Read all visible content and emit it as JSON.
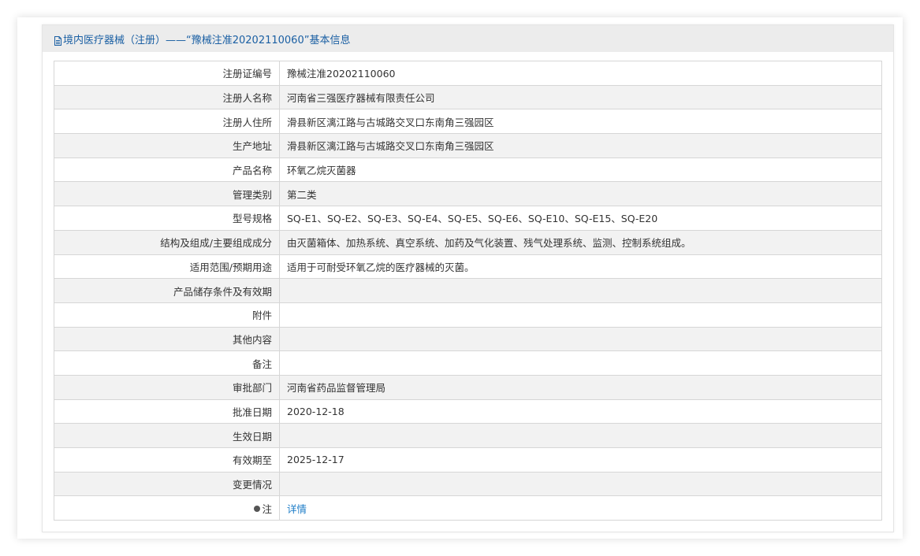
{
  "header": {
    "icon": "document-icon",
    "title": "境内医疗器械（注册）——“豫械注准20202110060”基本信息"
  },
  "rows": [
    {
      "label": "注册证编号",
      "value": "豫械注准20202110060"
    },
    {
      "label": "注册人名称",
      "value": "河南省三强医疗器械有限责任公司"
    },
    {
      "label": "注册人住所",
      "value": "滑县新区漓江路与古城路交叉口东南角三强园区"
    },
    {
      "label": "生产地址",
      "value": "滑县新区漓江路与古城路交叉口东南角三强园区"
    },
    {
      "label": "产品名称",
      "value": "环氧乙烷灭菌器"
    },
    {
      "label": "管理类别",
      "value": "第二类"
    },
    {
      "label": "型号规格",
      "value": "SQ-E1、SQ-E2、SQ-E3、SQ-E4、SQ-E5、SQ-E6、SQ-E10、SQ-E15、SQ-E20"
    },
    {
      "label": "结构及组成/主要组成成分",
      "value": "由灭菌箱体、加热系统、真空系统、加药及气化装置、残气处理系统、监测、控制系统组成。"
    },
    {
      "label": "适用范围/预期用途",
      "value": "适用于可耐受环氧乙烷的医疗器械的灭菌。"
    },
    {
      "label": "产品储存条件及有效期",
      "value": ""
    },
    {
      "label": "附件",
      "value": ""
    },
    {
      "label": "其他内容",
      "value": ""
    },
    {
      "label": "备注",
      "value": ""
    },
    {
      "label": "审批部门",
      "value": "河南省药品监督管理局"
    },
    {
      "label": "批准日期",
      "value": "2020-12-18"
    },
    {
      "label": "生效日期",
      "value": ""
    },
    {
      "label": "有效期至",
      "value": "2025-12-17"
    },
    {
      "label": "变更情况",
      "value": ""
    }
  ],
  "note_row": {
    "icon": "bulb-icon",
    "label": "注",
    "link_text": "详情"
  },
  "colors": {
    "title": "#1a5fa3",
    "link": "#1c7cc7",
    "header_bg": "#ececec",
    "stripe": "#f2f2f2"
  }
}
